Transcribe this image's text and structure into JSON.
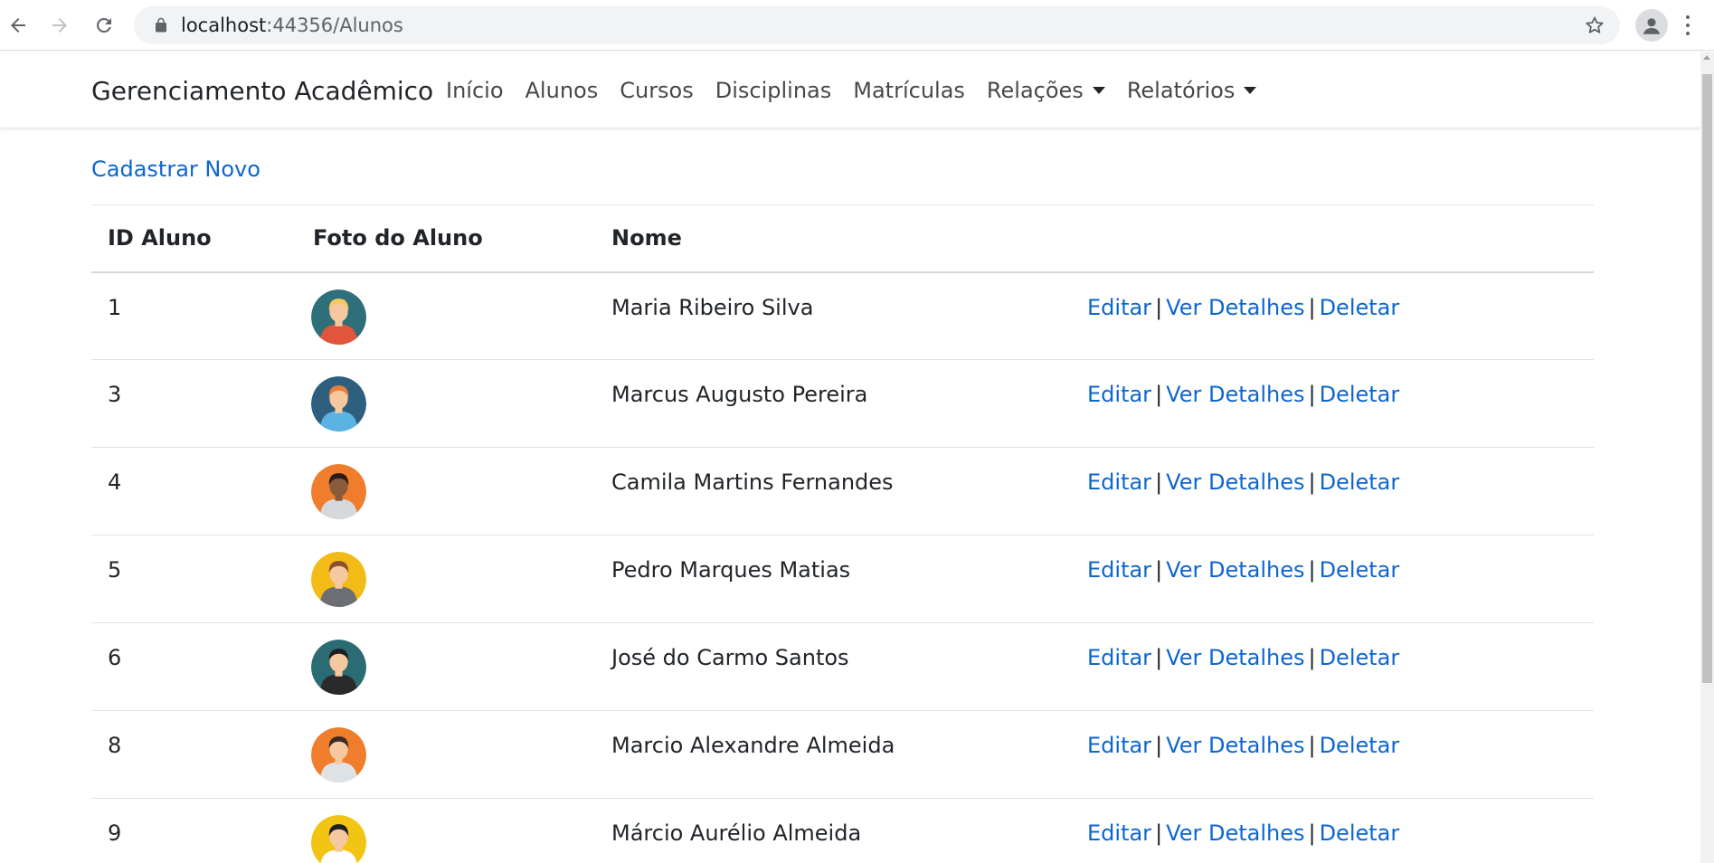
{
  "browser": {
    "url_host": "localhost",
    "url_rest": ":44356/Alunos",
    "icons": [
      "back-arrow-icon",
      "forward-arrow-icon",
      "reload-icon",
      "lock-icon",
      "star-icon",
      "profile-icon",
      "menu-dots-icon"
    ]
  },
  "navbar": {
    "brand": "Gerenciamento Acadêmico",
    "items": [
      {
        "label": "Início",
        "dropdown": false
      },
      {
        "label": "Alunos",
        "dropdown": false
      },
      {
        "label": "Cursos",
        "dropdown": false
      },
      {
        "label": "Disciplinas",
        "dropdown": false
      },
      {
        "label": "Matrículas",
        "dropdown": false
      },
      {
        "label": "Relações",
        "dropdown": true
      },
      {
        "label": "Relatórios",
        "dropdown": true
      }
    ]
  },
  "main": {
    "create_link": "Cadastrar Novo",
    "table": {
      "headers": [
        "ID Aluno",
        "Foto do Aluno",
        "Nome",
        ""
      ],
      "actions": {
        "edit": "Editar",
        "details": "Ver Detalhes",
        "delete": "Deletar",
        "separator": "|"
      },
      "rows": [
        {
          "id": "1",
          "nome": "Maria Ribeiro Silva",
          "avatar": "woman-blonde-avatar",
          "bg": "#2f6f7a",
          "skin": "#f6c8a0",
          "hair": "#f5c861",
          "shirt": "#e0553b"
        },
        {
          "id": "3",
          "nome": "Marcus Augusto Pereira",
          "avatar": "man-glasses-avatar",
          "bg": "#2e5f7e",
          "skin": "#f6c8a0",
          "hair": "#e87e3a",
          "shirt": "#5bb3e4"
        },
        {
          "id": "4",
          "nome": "Camila Martins Fernandes",
          "avatar": "woman-dark-hair-avatar",
          "bg": "#ef7d2b",
          "skin": "#8a5a3c",
          "hair": "#2b1a12",
          "shirt": "#d6d9dc"
        },
        {
          "id": "5",
          "nome": "Pedro Marques Matias",
          "avatar": "man-hoodie-avatar",
          "bg": "#f2bb16",
          "skin": "#f6c8a0",
          "hair": "#8a4f2c",
          "shirt": "#6b6e72"
        },
        {
          "id": "6",
          "nome": "José do Carmo Santos",
          "avatar": "man-suit-avatar",
          "bg": "#2b6b74",
          "skin": "#f6c8a0",
          "hair": "#1f1f1f",
          "shirt": "#2a2a2a"
        },
        {
          "id": "8",
          "nome": "Marcio Alexandre Almeida",
          "avatar": "man-tie-avatar",
          "bg": "#ef7d2b",
          "skin": "#f6c8a0",
          "hair": "#3b2a20",
          "shirt": "#dfe2e5"
        },
        {
          "id": "9",
          "nome": "Márcio Aurélio Almeida",
          "avatar": "man-backpack-avatar",
          "bg": "#f2c414",
          "skin": "#f6c8a0",
          "hair": "#1f1f1f",
          "shirt": "#ffffff"
        }
      ]
    }
  }
}
